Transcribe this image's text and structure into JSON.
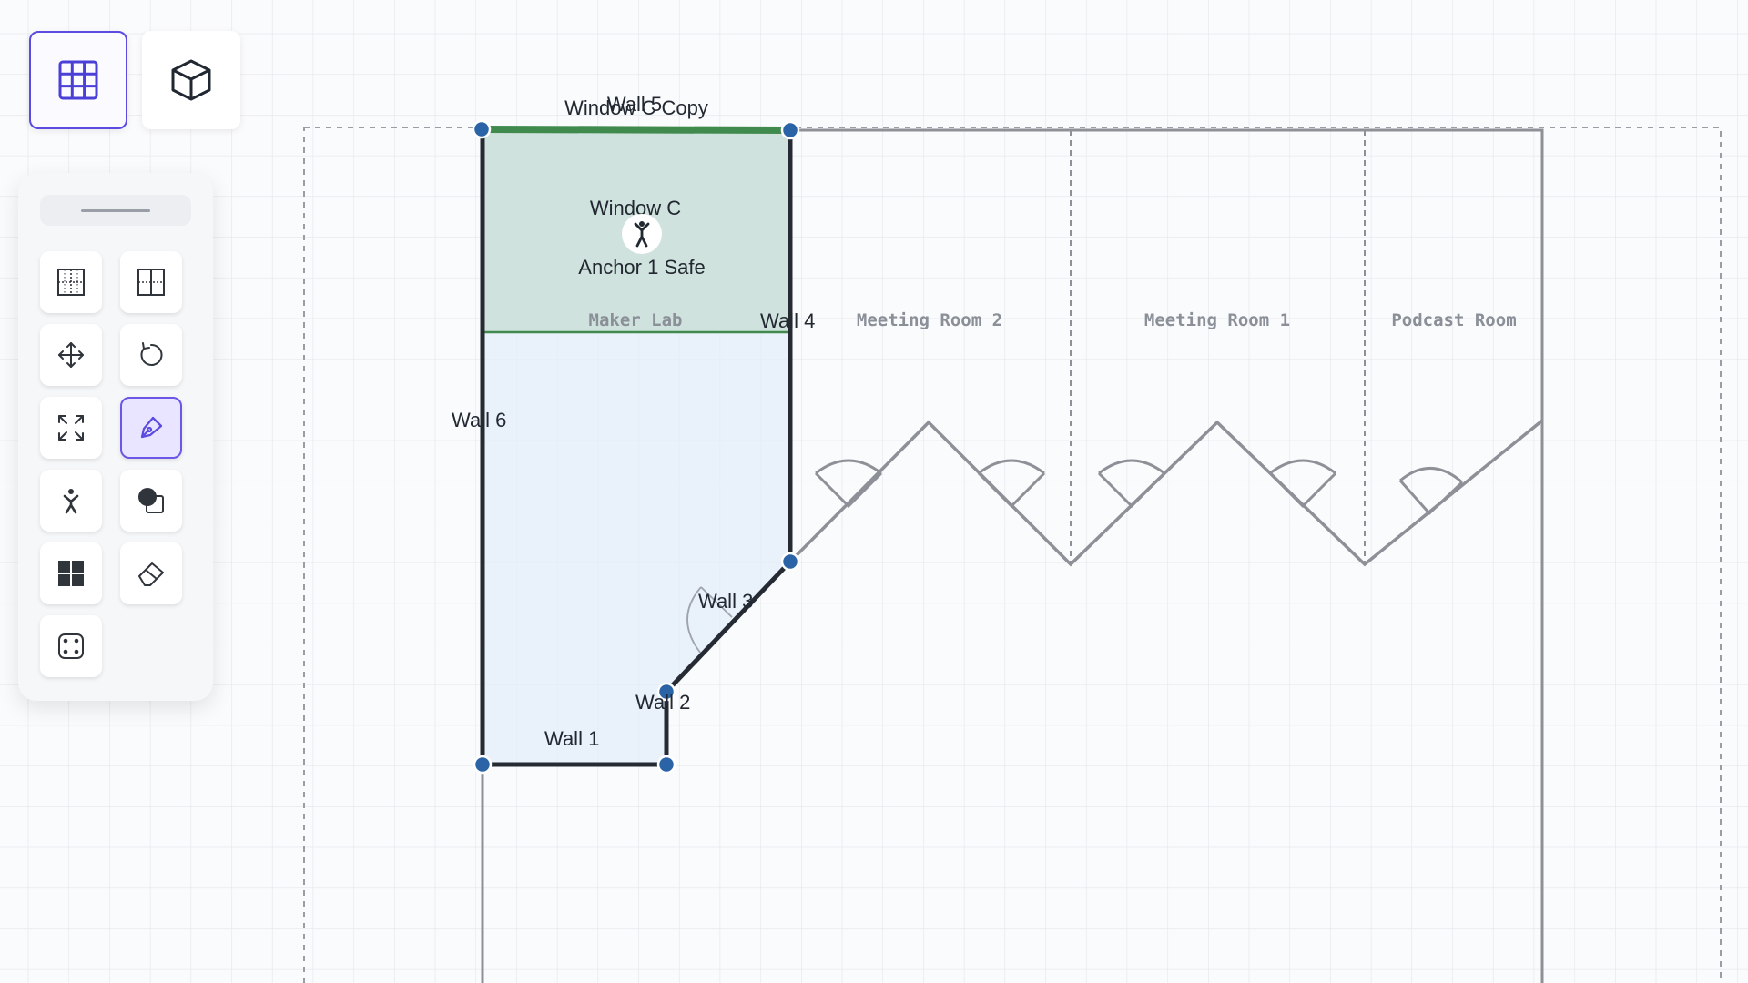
{
  "view_toggle": {
    "plan_view_icon": "grid-icon",
    "view_3d_icon": "cube-icon"
  },
  "toolbar": {
    "tools": [
      {
        "name": "dotted-grid-tool",
        "icon": "grid-dashed-icon"
      },
      {
        "name": "divider-tool",
        "icon": "grid-divider-icon"
      },
      {
        "name": "move-tool",
        "icon": "move-arrows-icon"
      },
      {
        "name": "rotate-tool",
        "icon": "rotate-icon"
      },
      {
        "name": "resize-tool",
        "icon": "expand-icon"
      },
      {
        "name": "pen-tool",
        "icon": "pen-icon",
        "active": true
      },
      {
        "name": "person-tool",
        "icon": "person-icon"
      },
      {
        "name": "shape-tool",
        "icon": "shapes-icon"
      },
      {
        "name": "tiles-tool",
        "icon": "tiles-icon"
      },
      {
        "name": "eraser-tool",
        "icon": "eraser-icon"
      },
      {
        "name": "anchor-points-tool",
        "icon": "dice-four-icon"
      }
    ]
  },
  "floorplan": {
    "walls": {
      "wall1": "Wall 1",
      "wall2": "Wall 2",
      "wall3": "Wall 3",
      "wall4": "Wall 4",
      "wall5": "Wall 5",
      "wall6": "Wall 6"
    },
    "window_copy_label": "Window C Copy",
    "window_label": "Window C",
    "anchor_label": "Anchor 1 Safe",
    "rooms": {
      "maker_lab": "Maker Lab",
      "meeting_room_2": "Meeting Room 2",
      "meeting_room_1": "Meeting Room 1",
      "podcast_room": "Podcast Room"
    }
  },
  "colors": {
    "accent": "#5b4be0",
    "selected_zone": "#3f8a4c",
    "vertex": "#2a63a6",
    "wall": "#262b33",
    "drawing_fill": "#e3edf9"
  }
}
